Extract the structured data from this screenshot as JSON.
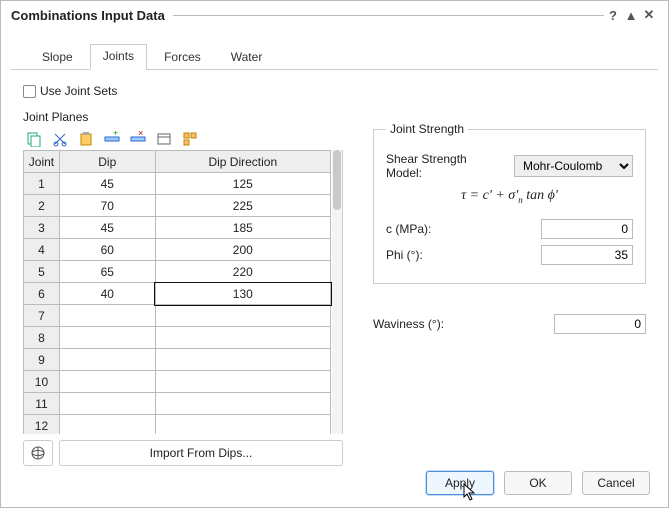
{
  "window": {
    "title": "Combinations Input Data",
    "help_tooltip": "Help"
  },
  "tabs": [
    "Slope",
    "Joints",
    "Forces",
    "Water"
  ],
  "active_tab_index": 1,
  "joints_section": {
    "use_joint_sets_label": "Use Joint Sets",
    "use_joint_sets_checked": false,
    "planes_label": "Joint Planes",
    "columns": {
      "row": "Joint",
      "dip": "Dip",
      "dir": "Dip Direction"
    },
    "rows": [
      {
        "n": 1,
        "dip": "45",
        "dir": "125"
      },
      {
        "n": 2,
        "dip": "70",
        "dir": "225"
      },
      {
        "n": 3,
        "dip": "45",
        "dir": "185"
      },
      {
        "n": 4,
        "dip": "60",
        "dir": "200"
      },
      {
        "n": 5,
        "dip": "65",
        "dir": "220"
      },
      {
        "n": 6,
        "dip": "40",
        "dir": "130"
      },
      {
        "n": 7,
        "dip": "",
        "dir": ""
      },
      {
        "n": 8,
        "dip": "",
        "dir": ""
      },
      {
        "n": 9,
        "dip": "",
        "dir": ""
      },
      {
        "n": 10,
        "dip": "",
        "dir": ""
      },
      {
        "n": 11,
        "dip": "",
        "dir": ""
      },
      {
        "n": 12,
        "dip": "",
        "dir": ""
      }
    ],
    "selected_row_index": 5,
    "selected_column": "dir",
    "import_label": "Import From Dips..."
  },
  "strength": {
    "legend": "Joint Strength",
    "model_label": "Shear Strength Model:",
    "model_value": "Mohr-Coulomb",
    "formula_html": "τ = c' + σ'<sub class='subn'>n</sub> tan ϕ'",
    "c_label": "c (MPa):",
    "c_value": "0",
    "phi_label": "Phi (°):",
    "phi_value": "35"
  },
  "waviness": {
    "label": "Waviness (°):",
    "value": "0"
  },
  "buttons": {
    "apply": "Apply",
    "ok": "OK",
    "cancel": "Cancel"
  },
  "toolbar_icons": [
    "copy-icon",
    "cut-icon",
    "paste-icon",
    "insert-row-icon",
    "delete-row-icon",
    "window-icon",
    "batch-icon"
  ]
}
